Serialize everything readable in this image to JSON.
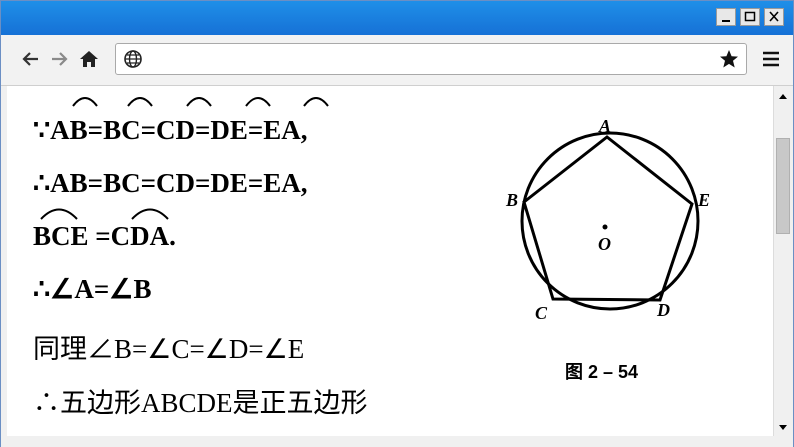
{
  "window": {
    "minimize_icon": "minimize-icon",
    "maximize_icon": "maximize-icon",
    "close_icon": "close-icon",
    "titlebar_color": "#1f8fe8"
  },
  "toolbar": {
    "back_icon": "arrow-left-icon",
    "forward_icon": "arrow-right-icon",
    "home_icon": "home-icon",
    "globe_icon": "globe-icon",
    "url": "",
    "bookmark_icon": "star-icon",
    "menu_icon": "hamburger-menu-icon"
  },
  "slide": {
    "lines": [
      "∵AB=BC=CD=DE=EA,",
      "∴AB=BC=CD=DE=EA,",
      "BCE =CDA.",
      "∴∠A=∠B",
      "同理∠B=∠C=∠D=∠E",
      "∴五边形ABCDE是正五边形"
    ],
    "figure": {
      "vertex_labels": [
        "A",
        "B",
        "C",
        "D",
        "E"
      ],
      "center_label": "O",
      "caption": "图 2 – 54"
    }
  }
}
